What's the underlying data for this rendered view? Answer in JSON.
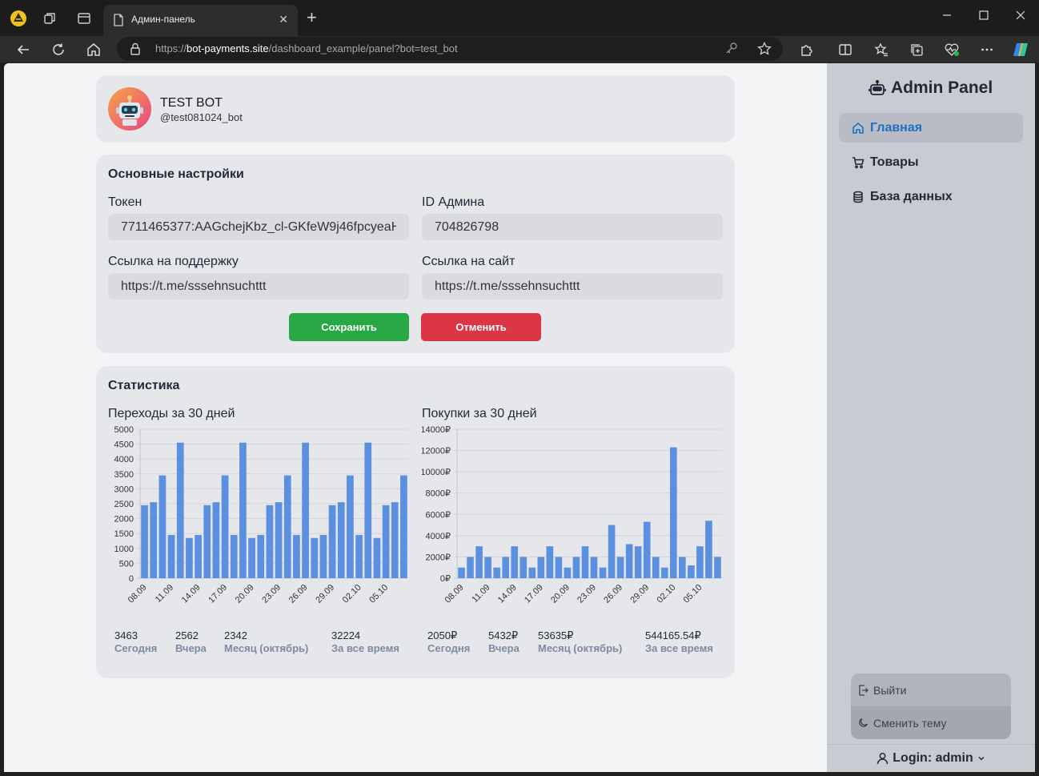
{
  "browser": {
    "tab_title": "Админ-панель",
    "url_prefix": "https://",
    "url_host": "bot-payments.site",
    "url_path": "/dashboard_example/panel?bot=test_bot"
  },
  "bot": {
    "name": "TEST BOT",
    "handle": "@test081024_bot"
  },
  "settings": {
    "title": "Основные настройки",
    "token_label": "Токен",
    "token_value": "7711465377:AAGchejKbz_cl-GKfeW9j46fpcyeaH",
    "admin_label": "ID Админа",
    "admin_value": "704826798",
    "support_label": "Ссылка на поддержку",
    "support_value": "https://t.me/sssehnsuchttt",
    "site_label": "Ссылка на сайт",
    "site_value": "https://t.me/sssehnsuchttt",
    "save_label": "Сохранить",
    "cancel_label": "Отменить"
  },
  "stats": {
    "title": "Статистика",
    "visits": {
      "title": "Переходы за 30 дней",
      "today": "3463",
      "today_label": "Сегодня",
      "yesterday": "2562",
      "yesterday_label": "Вчера",
      "month": "2342",
      "month_label": "Месяц (октябрь)",
      "all": "32224",
      "all_label": "За все время"
    },
    "purchases": {
      "title": "Покупки за 30 дней",
      "today": "2050₽",
      "today_label": "Сегодня",
      "yesterday": "5432₽",
      "yesterday_label": "Вчера",
      "month": "53635₽",
      "month_label": "Месяц (октябрь)",
      "all": "544165.54₽",
      "all_label": "За все время"
    }
  },
  "chart_data": [
    {
      "type": "bar",
      "title": "Переходы за 30 дней",
      "xlabel": "",
      "ylabel": "",
      "ylim": [
        0,
        5000
      ],
      "yticks": [
        "0",
        "500",
        "1000",
        "1500",
        "2000",
        "2500",
        "3000",
        "3500",
        "4000",
        "4500",
        "5000"
      ],
      "x_tick_labels": [
        "08.09",
        "11.09",
        "14.09",
        "17.09",
        "20.09",
        "23.09",
        "26.09",
        "29.09",
        "02.10",
        "05.10"
      ],
      "values": [
        2450,
        2550,
        3450,
        1450,
        4550,
        1350,
        1450,
        2450,
        2550,
        3450,
        1450,
        4550,
        1350,
        1450,
        2450,
        2550,
        3450,
        1450,
        4550,
        1350,
        1450,
        2450,
        2550,
        3450,
        1450,
        4550,
        1350,
        2450,
        2550,
        3450
      ],
      "color": "#5b8fe0",
      "grid": true
    },
    {
      "type": "bar",
      "title": "Покупки за 30 дней",
      "xlabel": "",
      "ylabel": "",
      "ylim": [
        0,
        14000
      ],
      "yticks": [
        "0₽",
        "2000₽",
        "4000₽",
        "6000₽",
        "8000₽",
        "10000₽",
        "12000₽",
        "14000₽"
      ],
      "x_tick_labels": [
        "08.09",
        "11.09",
        "14.09",
        "17.09",
        "20.09",
        "23.09",
        "26.09",
        "29.09",
        "02.10",
        "05.10"
      ],
      "values": [
        1000,
        2000,
        3000,
        2000,
        1000,
        2000,
        3000,
        2000,
        1000,
        2000,
        3000,
        2000,
        1000,
        2000,
        3000,
        2000,
        1000,
        5000,
        2000,
        3200,
        3000,
        5300,
        2000,
        1000,
        12300,
        2000,
        1200,
        3000,
        5400,
        2000
      ],
      "color": "#5b8fe0",
      "grid": true
    }
  ],
  "sidebar": {
    "brand": "Admin Panel",
    "items": [
      {
        "label": "Главная",
        "active": true
      },
      {
        "label": "Товары"
      },
      {
        "label": "База данных"
      }
    ],
    "logout_label": "Выйти",
    "theme_label": "Сменить тему",
    "login_label": "Login: admin"
  }
}
